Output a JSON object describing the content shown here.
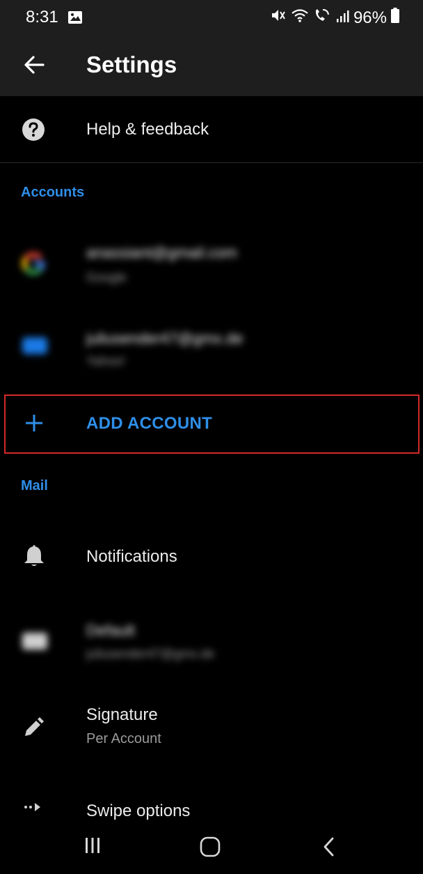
{
  "status_bar": {
    "time": "8:31",
    "battery": "96%"
  },
  "header": {
    "title": "Settings"
  },
  "help": {
    "label": "Help & feedback"
  },
  "accounts_section": {
    "title": "Accounts",
    "accounts": [
      {
        "email": "anassiant@gmail.com",
        "type": "Google"
      },
      {
        "email": "juliusender47@gmx.de",
        "type": "Yahoo!"
      }
    ],
    "add_account_label": "ADD ACCOUNT"
  },
  "mail_section": {
    "title": "Mail",
    "notifications_label": "Notifications",
    "default_account": {
      "label": "Default",
      "email": "juliusender47@gmx.de"
    },
    "signature": {
      "label": "Signature",
      "value": "Per Account"
    },
    "swipe_label": "Swipe options"
  },
  "colors": {
    "accent": "#2f8fe8",
    "highlight_border": "#d22a2a",
    "appbar_bg": "#1e1e1e",
    "background": "#000000"
  }
}
